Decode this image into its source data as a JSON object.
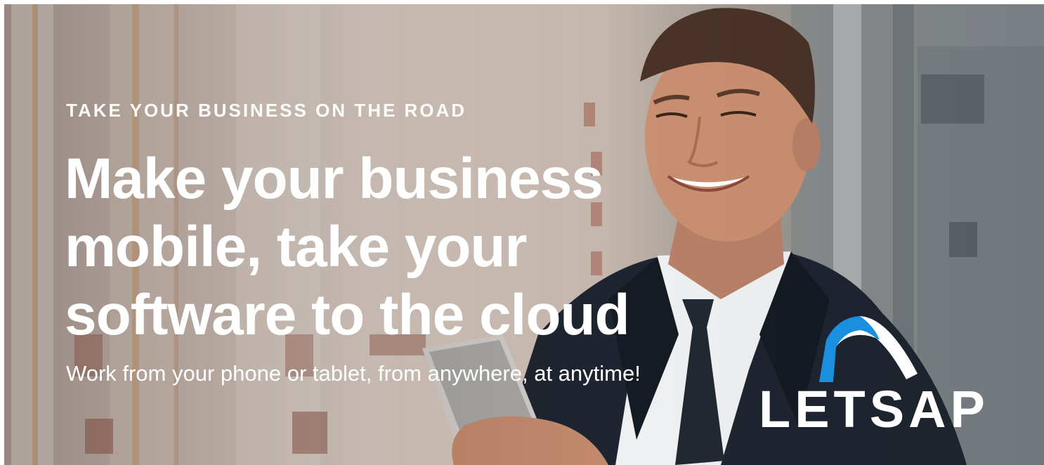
{
  "banner": {
    "eyebrow": "TAKE YOUR BUSINESS ON THE ROAD",
    "headline_lines": [
      "Make your business",
      "mobile, take your",
      "software to the cloud"
    ],
    "subtitle": "Work from your phone or tablet, from anywhere, at anytime!"
  },
  "logo": {
    "text": "LETSAP",
    "arc_color": "#1a8fe0"
  },
  "colors": {
    "text": "#ffffff",
    "suit": "#1e2530",
    "shirt": "#eef0f2",
    "skin": "#c98f70"
  }
}
